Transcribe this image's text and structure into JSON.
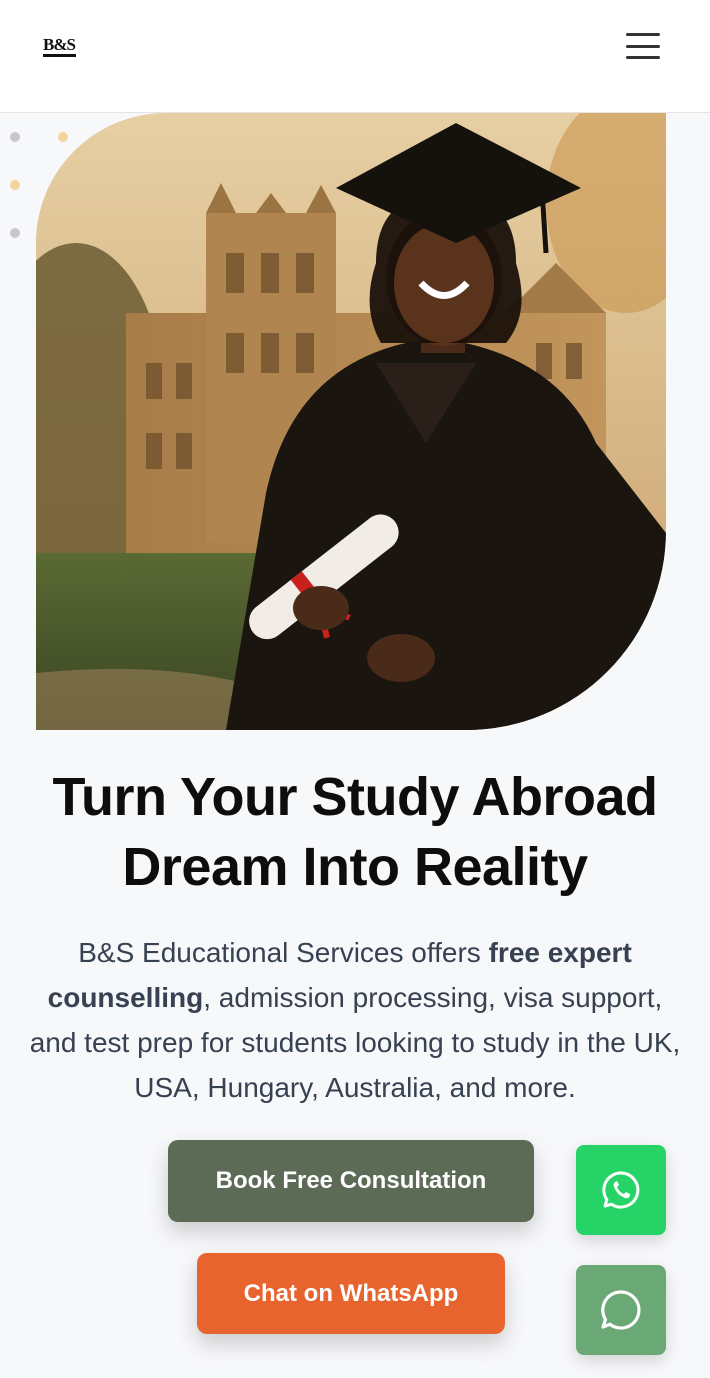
{
  "header": {
    "logo_text": "B&S",
    "menu_icon": "hamburger-icon"
  },
  "hero": {
    "image_icon": "graduate-photo",
    "headline_line1": "Turn Your Study Abroad",
    "headline_line2": "Dream Into Reality",
    "subtext_part1": "B&S Educational Services offers ",
    "subtext_bold": "free expert counselling",
    "subtext_part2": ", admission processing, visa support, and test prep for students looking to study in the UK, USA, Hungary, Australia, and more."
  },
  "buttons": {
    "consultation_label": "Book Free Consultation",
    "whatsapp_label": "Chat on WhatsApp"
  },
  "floating": {
    "whatsapp_icon": "whatsapp-icon",
    "chat_icon": "chat-bubble-icon"
  },
  "colors": {
    "consultation_button": "#5c6b55",
    "whatsapp_button": "#e8642f",
    "whatsapp_fab": "#25d366",
    "chat_fab": "#6aa875"
  }
}
